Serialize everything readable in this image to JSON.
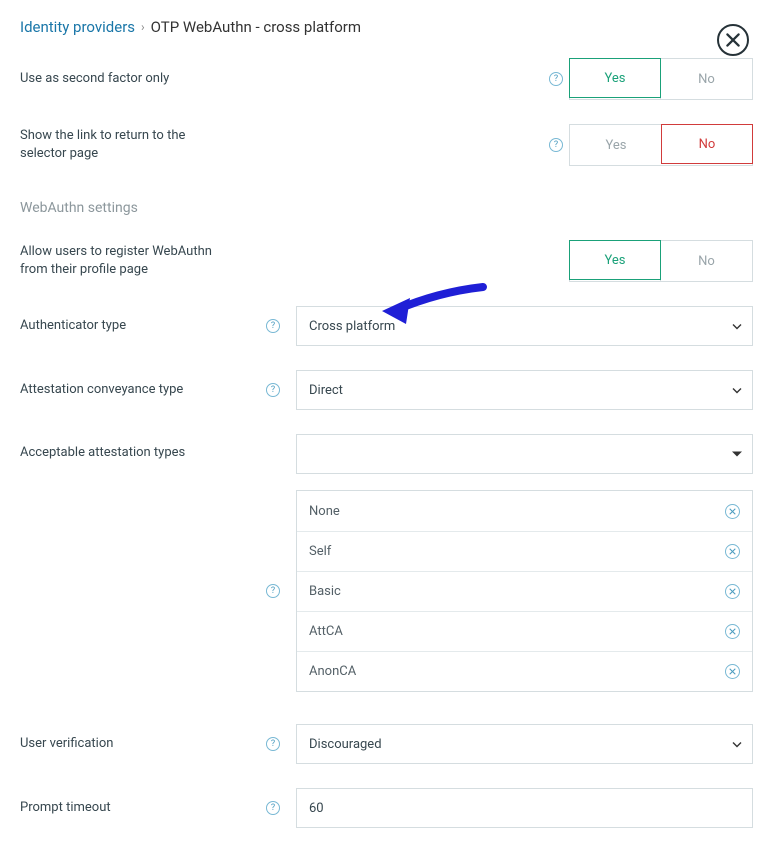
{
  "breadcrumb": {
    "link": "Identity providers",
    "current": "OTP WebAuthn - cross platform"
  },
  "labels": {
    "second_factor": "Use as second factor only",
    "show_link": "Show the link to return to the selector page",
    "section": "WebAuthn settings",
    "allow_register": "Allow users to register WebAuthn from their profile page",
    "auth_type": "Authenticator type",
    "attestation_conveyance": "Attestation conveyance type",
    "acceptable_att": "Acceptable attestation types",
    "user_verification": "User verification",
    "prompt_timeout": "Prompt timeout"
  },
  "toggle": {
    "yes": "Yes",
    "no": "No"
  },
  "values": {
    "second_factor": "Yes",
    "show_link": "No",
    "allow_register": "Yes",
    "auth_type": "Cross platform",
    "attestation_conveyance": "Direct",
    "acceptable_att_selected": "",
    "user_verification": "Discouraged",
    "prompt_timeout": "60"
  },
  "attestation_types": {
    "items": [
      {
        "label": "None"
      },
      {
        "label": "Self"
      },
      {
        "label": "Basic"
      },
      {
        "label": "AttCA"
      },
      {
        "label": "AnonCA"
      }
    ]
  }
}
